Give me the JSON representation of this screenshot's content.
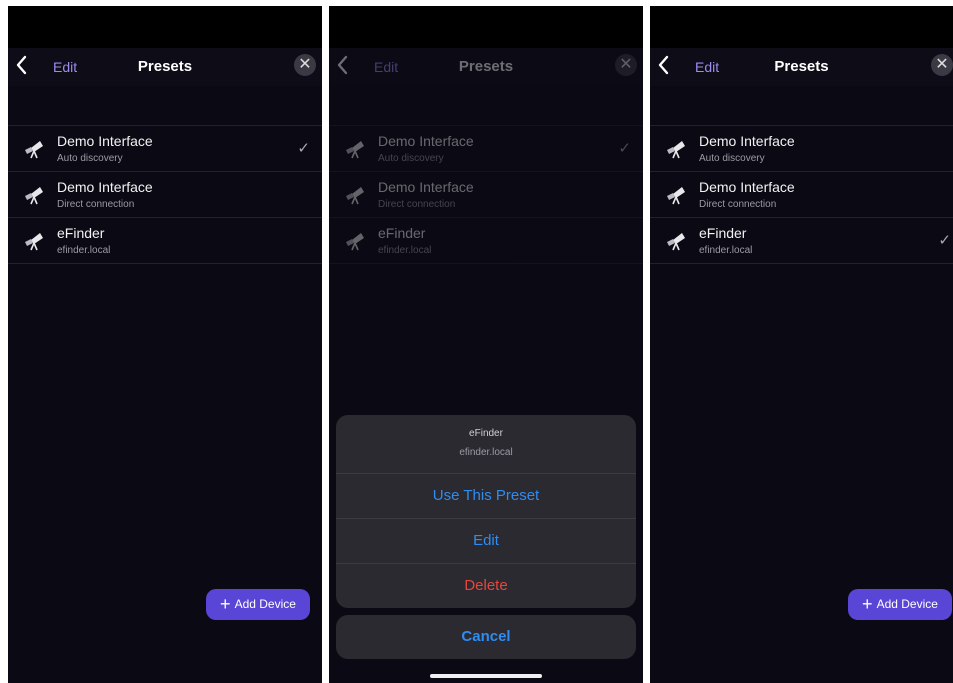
{
  "nav": {
    "back_icon": "chevron-left-icon",
    "edit_label": "Edit",
    "title": "Presets",
    "close_glyph": "✕"
  },
  "presets": [
    {
      "name": "Demo Interface",
      "detail": "Auto discovery",
      "icon": "telescope-icon"
    },
    {
      "name": "Demo Interface",
      "detail": "Direct connection",
      "icon": "telescope-icon"
    },
    {
      "name": "eFinder",
      "detail": "efinder.local",
      "icon": "telescope-icon"
    }
  ],
  "check_glyph": "✓",
  "add_button": {
    "plus": "+",
    "label": "Add Device"
  },
  "action_sheet": {
    "title": "eFinder",
    "subtitle": "efinder.local",
    "use": "Use This Preset",
    "edit": "Edit",
    "delete": "Delete",
    "cancel": "Cancel"
  },
  "colors": {
    "accent": "#5a46d6",
    "link": "#2f8cf0",
    "destructive": "#e5473c",
    "background": "#0b0a14"
  }
}
